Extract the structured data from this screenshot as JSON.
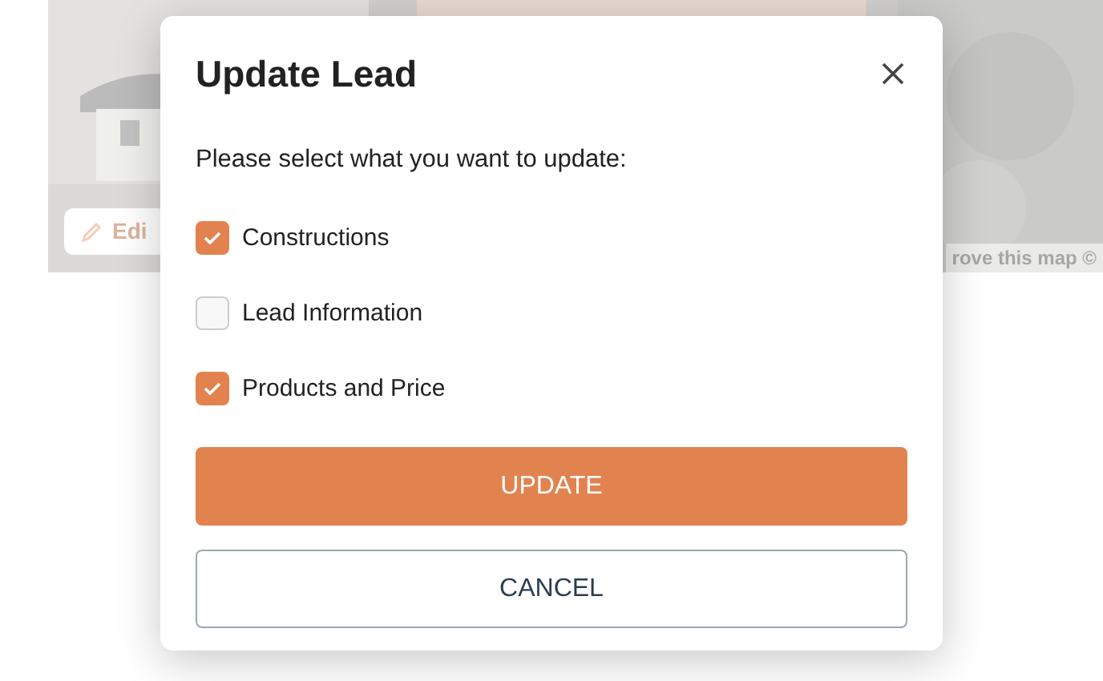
{
  "background": {
    "edit_button": "Edi",
    "map_attribution": "rove this map ©"
  },
  "dialog": {
    "title": "Update Lead",
    "prompt": "Please select what you want to update:",
    "options": [
      {
        "label": "Constructions",
        "checked": true
      },
      {
        "label": "Lead Information",
        "checked": false
      },
      {
        "label": "Products and Price",
        "checked": true
      }
    ],
    "primary_button": "UPDATE",
    "secondary_button": "CANCEL"
  }
}
